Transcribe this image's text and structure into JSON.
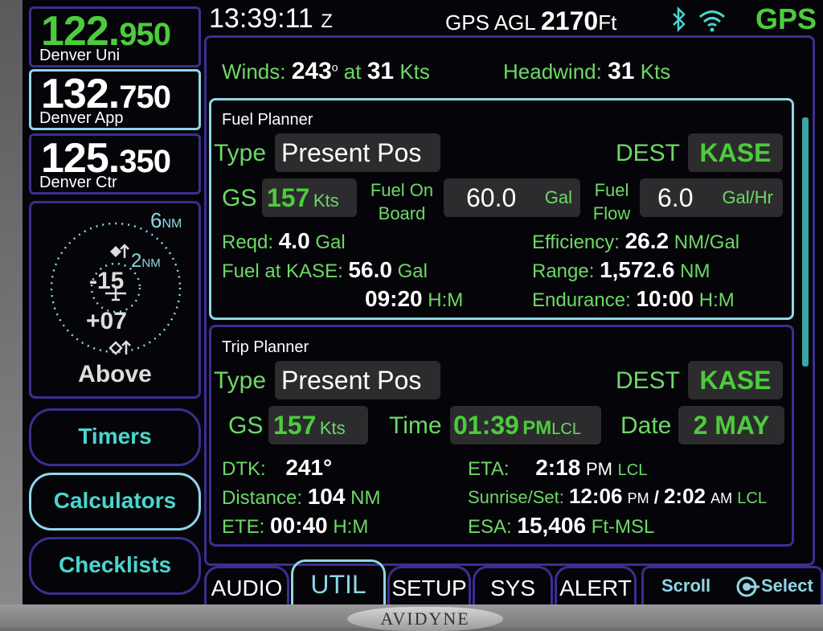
{
  "status_bar": {
    "time": "13:39:11",
    "time_zone": "Z",
    "agl_label": "GPS AGL",
    "agl_value": "2170",
    "agl_unit": "Ft",
    "source": "GPS"
  },
  "frequencies": [
    {
      "mhz": "122.",
      "khz": "950",
      "name": "Denver Uni",
      "color": "#4ccc3c"
    },
    {
      "mhz": "132.",
      "khz": "750",
      "name": "Denver App",
      "color": "#ffffff"
    },
    {
      "mhz": "125.",
      "khz": "350",
      "name": "Denver Ctr",
      "color": "#ffffff"
    }
  ],
  "traffic": {
    "range_outer": "6",
    "range_inner": "2",
    "unit": "NM",
    "target_top": "-15",
    "target_bottom": "+07",
    "mode": "Above"
  },
  "side_buttons": {
    "timers": "Timers",
    "calculators": "Calculators",
    "checklists": "Checklists"
  },
  "winds": {
    "label": "Winds:",
    "direction": "243",
    "deg": "o",
    "at": "at",
    "speed": "31",
    "unit": "Kts",
    "headwind_label": "Headwind:",
    "headwind_value": "31",
    "headwind_unit": "Kts"
  },
  "fuel_planner": {
    "title": "Fuel Planner",
    "type_label": "Type",
    "type_value": "Present Pos",
    "dest_label": "DEST",
    "dest_value": "KASE",
    "gs_label": "GS",
    "gs_value": "157",
    "gs_unit": "Kts",
    "fob_label_1": "Fuel On",
    "fob_label_2": "Board",
    "fob_value": "60.0",
    "fob_unit": "Gal",
    "flow_label_1": "Fuel",
    "flow_label_2": "Flow",
    "flow_value": "6.0",
    "flow_unit": "Gal/Hr",
    "reqd_label": "Reqd:",
    "reqd_value": "4.0",
    "reqd_unit": "Gal",
    "fuel_at_label": "Fuel at KASE:",
    "fuel_at_value": "56.0",
    "fuel_at_unit": "Gal",
    "time_value": "09:20",
    "time_unit": "H:M",
    "eff_label": "Efficiency:",
    "eff_value": "26.2",
    "eff_unit": "NM/Gal",
    "range_label": "Range:",
    "range_value": "1,572.6",
    "range_unit": "NM",
    "endur_label": "Endurance:",
    "endur_value": "10:00",
    "endur_unit": "H:M"
  },
  "trip_planner": {
    "title": "Trip Planner",
    "type_label": "Type",
    "type_value": "Present Pos",
    "dest_label": "DEST",
    "dest_value": "KASE",
    "gs_label": "GS",
    "gs_value": "157",
    "gs_unit": "Kts",
    "time_label": "Time",
    "time_value": "01:39",
    "time_ampm": "PM",
    "time_zone": "LCL",
    "date_label": "Date",
    "date_value": "2 MAY",
    "dtk_label": "DTK:",
    "dtk_value": "241°",
    "dist_label": "Distance:",
    "dist_value": "104",
    "dist_unit": "NM",
    "ete_label": "ETE:",
    "ete_value": "00:40",
    "ete_unit": "H:M",
    "eta_label": "ETA:",
    "eta_value": "2:18",
    "eta_ampm": "PM",
    "eta_zone": "LCL",
    "sun_label": "Sunrise/Set:",
    "sunrise": "12:06",
    "sunrise_ampm": "PM",
    "sep": "/",
    "sunset": "2:02",
    "sunset_ampm": "AM",
    "sun_zone": "LCL",
    "esa_label": "ESA:",
    "esa_value": "15,406",
    "esa_unit": "Ft-MSL"
  },
  "tabs": [
    "AUDIO",
    "UTIL",
    "SETUP",
    "SYS",
    "ALERT"
  ],
  "scroll_hint": {
    "scroll": "Scroll",
    "select": "Select"
  },
  "brand": "AVIDYNE"
}
